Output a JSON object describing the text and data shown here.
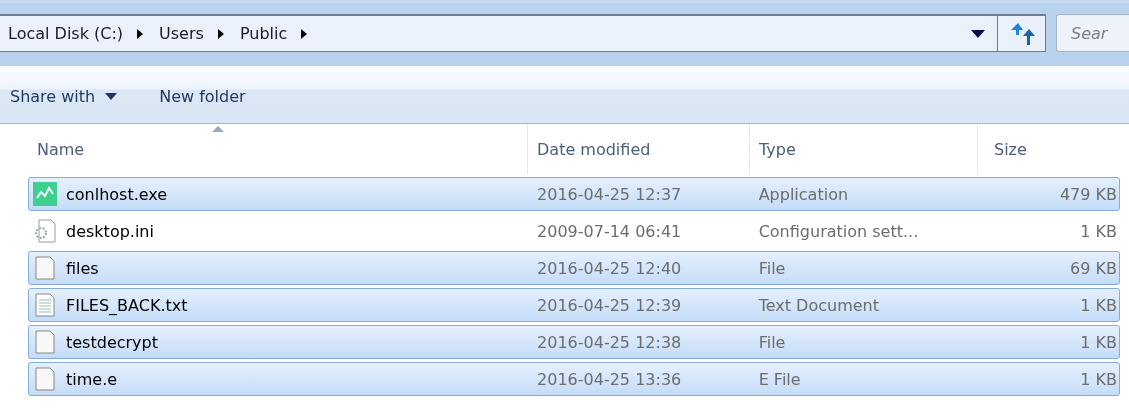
{
  "address_bar": {
    "crumbs": [
      "Local Disk (C:)",
      "Users",
      "Public"
    ]
  },
  "search": {
    "placeholder": "Sear"
  },
  "toolbar": {
    "buttons": [
      {
        "label": "Share with",
        "kind": "menu"
      },
      {
        "label": "New folder",
        "kind": "plain"
      }
    ]
  },
  "table": {
    "columns": [
      {
        "label": "Name",
        "sorted": true
      },
      {
        "label": "Date modified",
        "sorted": false
      },
      {
        "label": "Type",
        "sorted": false
      },
      {
        "label": "Size",
        "sorted": false
      }
    ],
    "rows": [
      {
        "kind": "app",
        "name": "conlhost.exe",
        "date": "2016-04-25 12:37",
        "type": "Application",
        "size": "479 KB",
        "selected": true
      },
      {
        "kind": "settings",
        "name": "desktop.ini",
        "date": "2009-07-14 06:41",
        "type": "Configuration sett...",
        "size": "1 KB",
        "selected": false
      },
      {
        "kind": "blank",
        "name": "files",
        "date": "2016-04-25 12:40",
        "type": "File",
        "size": "69 KB",
        "selected": true
      },
      {
        "kind": "text",
        "name": "FILES_BACK.txt",
        "date": "2016-04-25 12:39",
        "type": "Text Document",
        "size": "1 KB",
        "selected": true
      },
      {
        "kind": "blank",
        "name": "testdecrypt",
        "date": "2016-04-25 12:38",
        "type": "File",
        "size": "1 KB",
        "selected": true
      },
      {
        "kind": "blank",
        "name": "time.e",
        "date": "2016-04-25 13:36",
        "type": "E File",
        "size": "1 KB",
        "selected": true
      }
    ]
  }
}
